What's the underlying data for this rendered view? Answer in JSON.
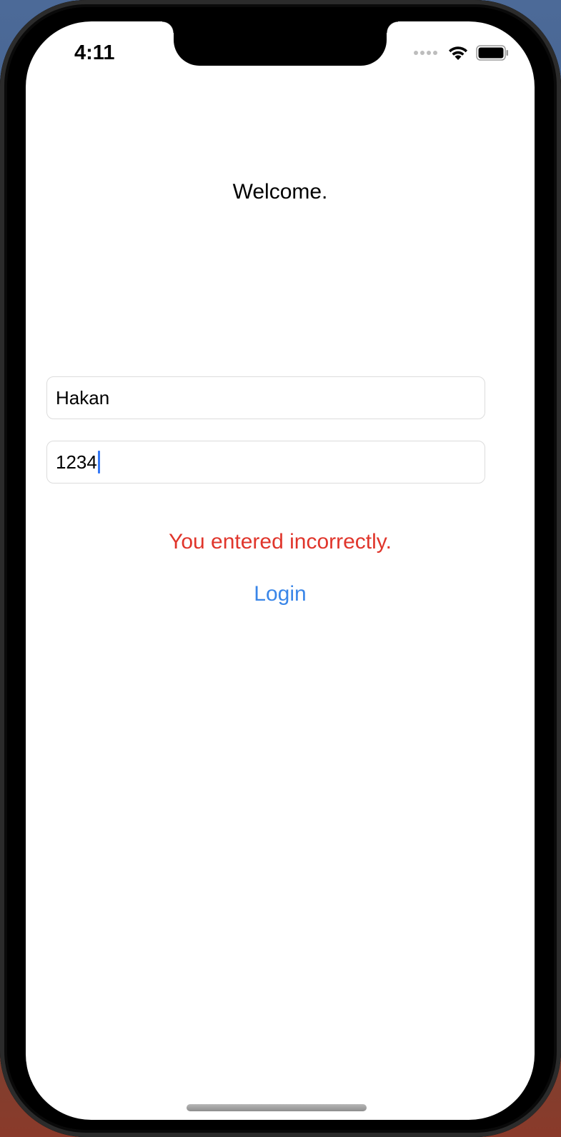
{
  "status_bar": {
    "time": "4:11",
    "icons": [
      "signal-dots-icon",
      "wifi-icon",
      "battery-icon"
    ]
  },
  "screen": {
    "title": "Welcome.",
    "username_value": "Hakan",
    "password_value": "1234",
    "error_message": "You entered incorrectly.",
    "login_label": "Login"
  },
  "colors": {
    "error": "#e0352b",
    "link": "#3a86e8",
    "caret": "#3478f6"
  }
}
